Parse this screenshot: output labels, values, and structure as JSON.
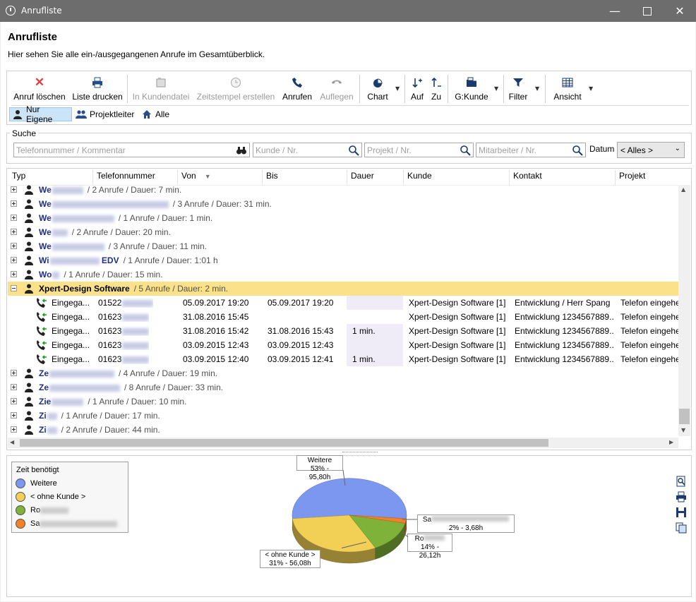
{
  "window": {
    "title": "Anrufliste"
  },
  "header": {
    "title": "Anrufliste",
    "subtitle": "Hier sehen Sie alle ein-/ausgegangenen Anrufe im Gesamtüberblick."
  },
  "toolbar": {
    "delete": "Anruf löschen",
    "print": "Liste drucken",
    "customer_file": "In Kundendatei",
    "timestamp": "Zeitstempel erstellen",
    "call": "Anrufen",
    "hangup": "Auflegen",
    "chart": "Chart",
    "sort_asc": "Auf",
    "sort_desc": "Zu",
    "group": "G:Kunde",
    "filter": "Filter",
    "view": "Ansicht"
  },
  "filters": {
    "own": "Nur Eigene",
    "project_lead": "Projektleiter",
    "all": "Alle"
  },
  "search": {
    "label": "Suche",
    "phone_placeholder": "Telefonnummer / Kommentar",
    "customer_placeholder": "Kunde / Nr.",
    "project_placeholder": "Projekt / Nr.",
    "employee_placeholder": "Mitarbeiter / Nr.",
    "date_label": "Datum",
    "date_value": "< Alles >"
  },
  "columns": [
    "Typ",
    "Telefonnummer",
    "Von",
    "Bis",
    "Dauer",
    "Kunde",
    "Kontakt",
    "Projekt"
  ],
  "groups_top": [
    {
      "name": "We",
      "meta": "/ 2 Anrufe / Dauer: 7 min."
    },
    {
      "name": "We",
      "meta": "/ 3 Anrufe / Dauer: 31 min."
    },
    {
      "name": "We",
      "meta": "/ 1 Anrufe / Dauer: 1 min."
    },
    {
      "name": "We",
      "meta": "/ 2 Anrufe / Dauer: 20 min."
    },
    {
      "name": "We",
      "meta": "/ 3 Anrufe / Dauer: 11 min."
    },
    {
      "name": "Wi",
      "name2": "EDV",
      "meta": "/ 1 Anrufe / Dauer: 1:01 h"
    },
    {
      "name": "Wo",
      "meta": "/ 1 Anrufe / Dauer: 15 min."
    }
  ],
  "expanded_group": {
    "name": "Xpert-Design Software",
    "meta": "/ 5 Anrufe / Dauer: 2 min."
  },
  "calls": [
    {
      "type": "Eingega...",
      "phone": "01522",
      "from": "05.09.2017 19:20",
      "to": "05.09.2017 19:20",
      "duration": "",
      "customer": "Xpert-Design Software [1]",
      "contact": "Entwicklung / Herr Spang",
      "project": "Telefon eingehe"
    },
    {
      "type": "Eingega...",
      "phone": "01623",
      "from": "31.08.2016 15:45",
      "to": "",
      "duration": "",
      "customer": "Xpert-Design Software [1]",
      "contact": "Entwicklung 1234567889...",
      "project": "Telefon eingehe"
    },
    {
      "type": "Eingega...",
      "phone": "01623",
      "from": "31.08.2016 15:42",
      "to": "31.08.2016 15:43",
      "duration": "1 min.",
      "customer": "Xpert-Design Software [1]",
      "contact": "Entwicklung 1234567889...",
      "project": "Telefon eingehe"
    },
    {
      "type": "Eingega...",
      "phone": "01623",
      "from": "03.09.2015 12:43",
      "to": "03.09.2015 12:43",
      "duration": "",
      "customer": "Xpert-Design Software [1]",
      "contact": "Entwicklung 1234567889...",
      "project": "Telefon eingehe"
    },
    {
      "type": "Eingega...",
      "phone": "01623",
      "from": "03.09.2015 12:40",
      "to": "03.09.2015 12:41",
      "duration": "1 min.",
      "customer": "Xpert-Design Software [1]",
      "contact": "Entwicklung 1234567889...",
      "project": "Telefon eingehe"
    }
  ],
  "groups_bottom": [
    {
      "name": "Ze",
      "meta": "/ 4 Anrufe / Dauer: 19 min."
    },
    {
      "name": "Ze",
      "meta": "/ 8 Anrufe / Dauer: 33 min."
    },
    {
      "name": "Zie",
      "meta": "/ 1 Anrufe / Dauer: 10 min."
    },
    {
      "name": "Zi",
      "meta": "/ 1 Anrufe / Dauer: 17 min."
    },
    {
      "name": "Zi",
      "meta": "/ 2 Anrufe / Dauer: 44 min."
    }
  ],
  "chart_data": {
    "type": "pie",
    "title": "Zeit benötigt",
    "legend_position": "top-left",
    "series": [
      {
        "name": "Weitere",
        "percent": 53,
        "hours": 95.8,
        "label": "53% - 95,80h",
        "color": "#7b97f0"
      },
      {
        "name": "< ohne Kunde >",
        "percent": 31,
        "hours": 56.08,
        "label": "31% - 56,08h",
        "color": "#f2d055"
      },
      {
        "name": "Ro",
        "percent": 14,
        "hours": 26.12,
        "label": "14% - 26,12h",
        "color": "#7fb238"
      },
      {
        "name": "Sa",
        "percent": 2,
        "hours": 3.68,
        "label": "2% - 3,68h",
        "color": "#f2812a"
      }
    ]
  },
  "colors": {
    "accent": "#1f2d8c",
    "highlight": "#fbe28a",
    "titlebar": "#6d6d6d"
  }
}
